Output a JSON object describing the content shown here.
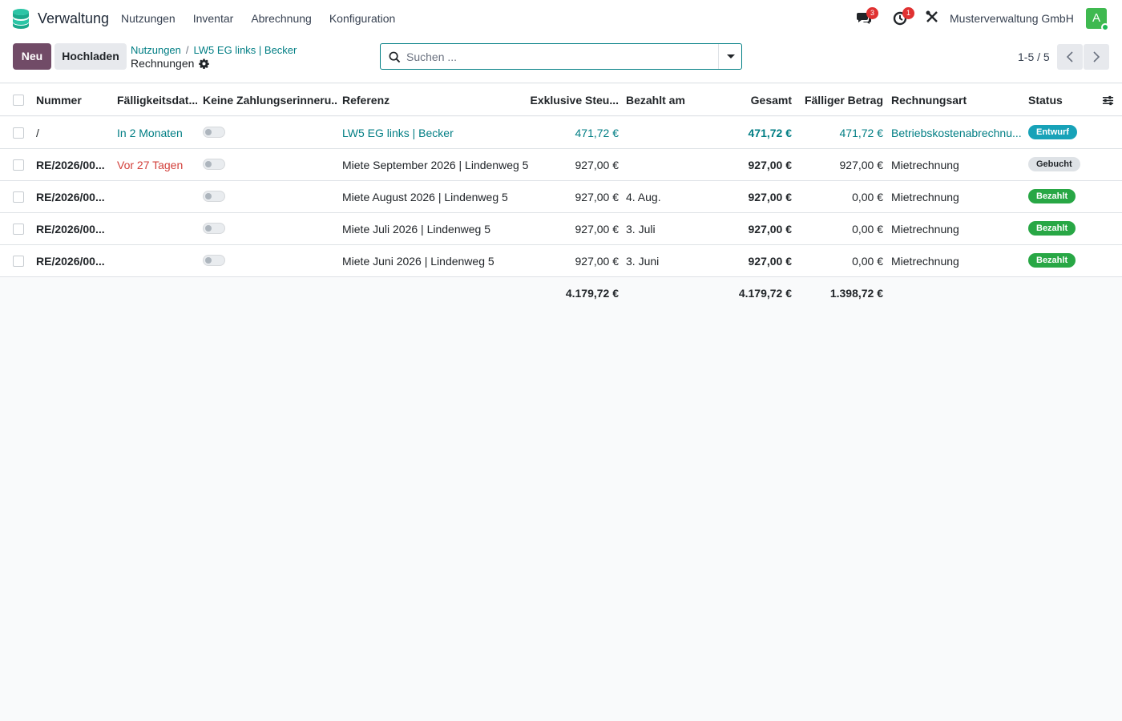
{
  "navbar": {
    "app_name": "Verwaltung",
    "menu": [
      "Nutzungen",
      "Inventar",
      "Abrechnung",
      "Konfiguration"
    ],
    "messages_badge": "3",
    "activities_badge": "1",
    "company": "Musterverwaltung GmbH",
    "avatar_letter": "A"
  },
  "control": {
    "new_label": "Neu",
    "upload_label": "Hochladen",
    "breadcrumb": [
      "Nutzungen",
      "LW5 EG links | Becker"
    ],
    "breadcrumb_sep": "/",
    "current": "Rechnungen",
    "search_placeholder": "Suchen ...",
    "pager": "1-5 / 5"
  },
  "table": {
    "columns": {
      "number": "Nummer",
      "due": "Fälligkeitsdat...",
      "no_reminder": "Keine Zahlungserinneru...",
      "reference": "Referenz",
      "untaxed": "Exklusive Steu...",
      "paid_on": "Bezahlt am",
      "total": "Gesamt",
      "due_amount": "Fälliger Betrag",
      "type": "Rechnungsart",
      "status": "Status"
    },
    "rows": [
      {
        "number": "/",
        "due": "In 2 Monaten",
        "reference": "LW5 EG links | Becker",
        "untaxed": "471,72 €",
        "paid_on": "",
        "total": "471,72 €",
        "due_amount": "471,72 €",
        "type": "Betriebskostenabrechnu...",
        "status": "Entwurf"
      },
      {
        "number": "RE/2026/00...",
        "due": "Vor 27 Tagen",
        "reference": "Miete September 2026 | Lindenweg 5",
        "untaxed": "927,00 €",
        "paid_on": "",
        "total": "927,00 €",
        "due_amount": "927,00 €",
        "type": "Mietrechnung",
        "status": "Gebucht"
      },
      {
        "number": "RE/2026/00...",
        "due": "",
        "reference": "Miete August 2026 | Lindenweg 5",
        "untaxed": "927,00 €",
        "paid_on": "4. Aug.",
        "total": "927,00 €",
        "due_amount": "0,00 €",
        "type": "Mietrechnung",
        "status": "Bezahlt"
      },
      {
        "number": "RE/2026/00...",
        "due": "",
        "reference": "Miete Juli 2026 | Lindenweg 5",
        "untaxed": "927,00 €",
        "paid_on": "3. Juli",
        "total": "927,00 €",
        "due_amount": "0,00 €",
        "type": "Mietrechnung",
        "status": "Bezahlt"
      },
      {
        "number": "RE/2026/00...",
        "due": "",
        "reference": "Miete Juni 2026 | Lindenweg 5",
        "untaxed": "927,00 €",
        "paid_on": "3. Juni",
        "total": "927,00 €",
        "due_amount": "0,00 €",
        "type": "Mietrechnung",
        "status": "Bezahlt"
      }
    ],
    "totals": {
      "untaxed": "4.179,72 €",
      "total": "4.179,72 €",
      "due_amount": "1.398,72 €"
    }
  },
  "colors": {
    "brand": "#714b67",
    "accent": "#017e84",
    "danger": "#d23f3a",
    "paid": "#28a745",
    "draft": "#17a2b8"
  }
}
